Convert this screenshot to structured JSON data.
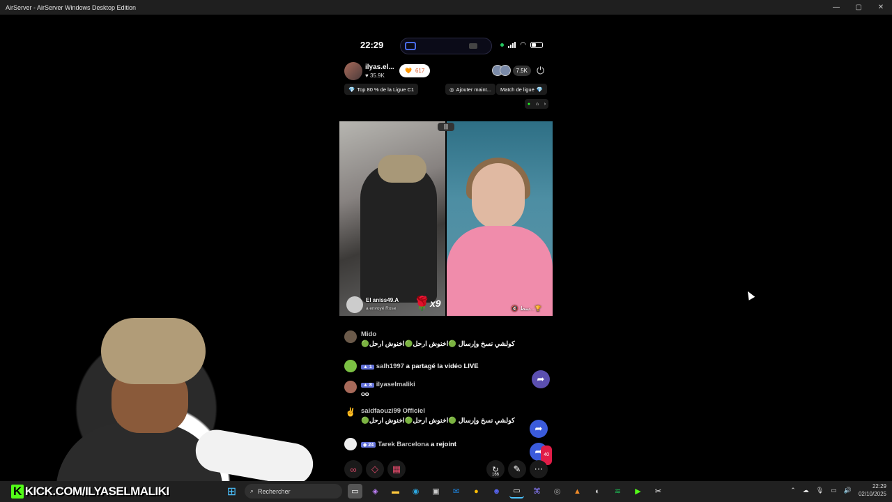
{
  "window": {
    "title": "AirServer - AirServer Windows Desktop Edition",
    "controls": {
      "minimize": "—",
      "maximize": "▢",
      "close": "✕"
    }
  },
  "phone": {
    "status": {
      "time": "22:29"
    },
    "host": {
      "name": "ilyas.el...",
      "likes": "♥ 35.9K",
      "coins": "617",
      "viewers": "7.5K"
    },
    "pills": {
      "rank": "Top 80 % de la Ligue C1",
      "add": "Ajouter maint...",
      "match": "Match de ligue"
    },
    "video": {
      "gift_sender": "El aniss49.A",
      "gift_sub": "a envoyé  Rose",
      "gift_count": "x9",
      "right_label": "🔇 سط...🏆"
    },
    "chat": [
      {
        "name": "Mido",
        "level": "",
        "text": "🟢كولشي نسخ وإرسال 🟢اخنوش ارحل🟢اخنوش ارحل"
      },
      {
        "name": "salh1997",
        "level": "1",
        "text": "a partagé la vidéo LIVE"
      },
      {
        "name": "ilyaselmaliki",
        "level": "8",
        "text": "oo"
      },
      {
        "name": "saidfaouzi99 Officiel",
        "level": "",
        "text": "🟢كولشي نسخ وإرسال 🟢اخنوش ارحل🟢اخنوش ارحل"
      },
      {
        "name": "Tarek Barcelona",
        "level": "24",
        "text": "a rejoint"
      }
    ],
    "share_badge": "40",
    "bottom": {
      "rewind_count": "166"
    }
  },
  "taskbar": {
    "overlay_text": "KICK.COM/ILYASELMALIKI",
    "search_placeholder": "Rechercher",
    "time": "22:29",
    "date": "02/10/2025"
  }
}
